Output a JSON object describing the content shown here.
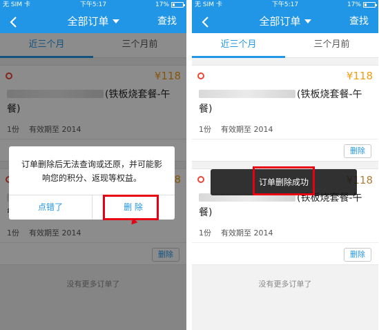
{
  "status": {
    "carrier": "无 SIM 卡",
    "time": "下午5:17",
    "battery": "17%"
  },
  "nav": {
    "title": "全部订单",
    "search": "查找"
  },
  "tabs": [
    "近三个月",
    "三个月前"
  ],
  "orders": [
    {
      "price": "¥118",
      "title": "(铁板烧套餐-午餐)",
      "qty": "1份",
      "valid": "有效期至 2014",
      "delete": "删除"
    },
    {
      "price": "¥118",
      "title": "(铁板烧套餐-午餐)",
      "qty": "1份",
      "valid": "有效期至 2014",
      "delete": "删除"
    }
  ],
  "footer": "没有更多订单了",
  "dialog": {
    "message": "订单删除后无法查询或还原，并可能影响您的积分、返现等权益。",
    "cancel": "点错了",
    "confirm": "删 除"
  },
  "toast": "订单删除成功",
  "colors": {
    "brand": "#2196e6",
    "price": "#f39c12",
    "highlight": "#e60012"
  }
}
